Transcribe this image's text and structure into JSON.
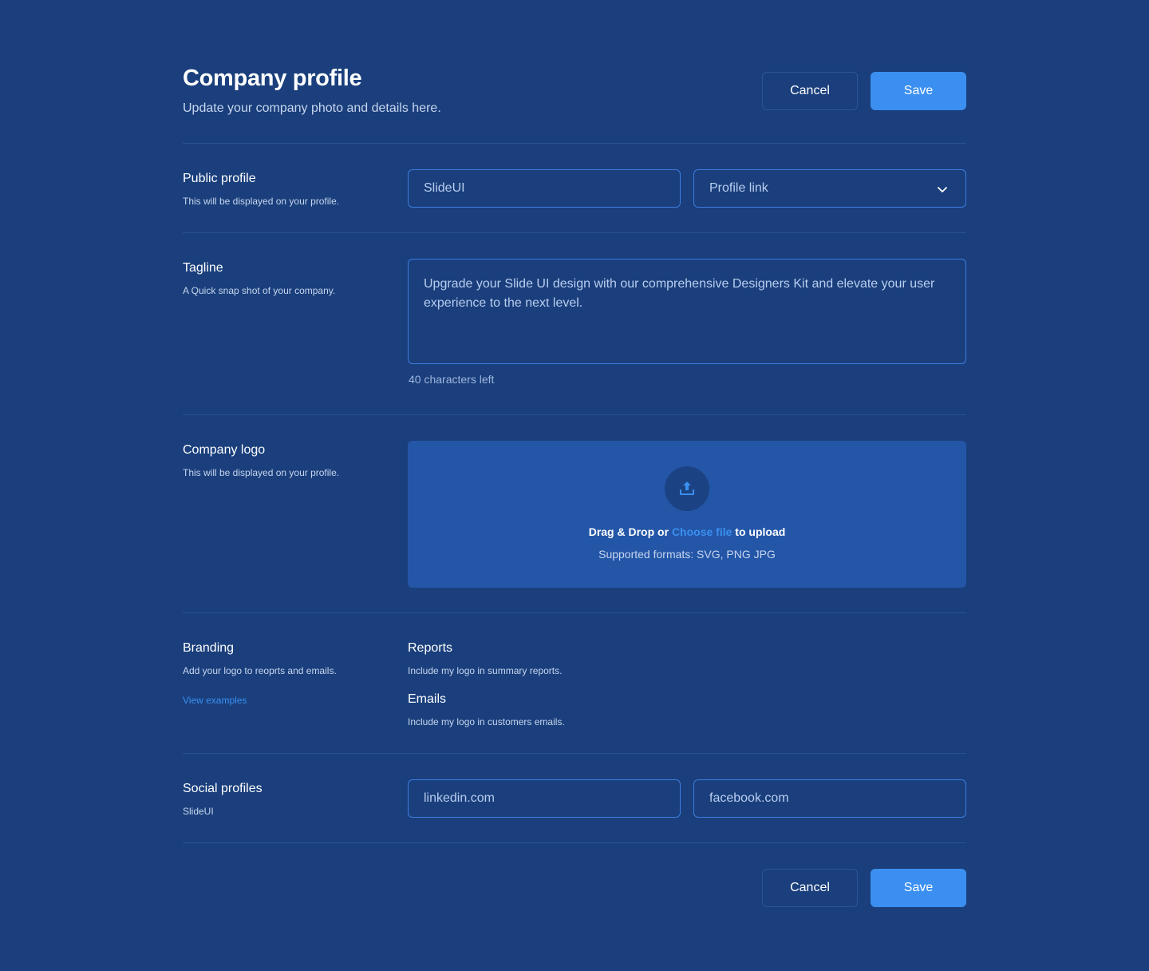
{
  "header": {
    "title": "Company profile",
    "subtitle": "Update your company photo and details here.",
    "cancel_label": "Cancel",
    "save_label": "Save"
  },
  "public_profile": {
    "title": "Public profile",
    "description": "This will be displayed on your profile.",
    "name_value": "SlideUI",
    "profile_link_placeholder": "Profile link",
    "chevron_icon": "chevron-down-icon"
  },
  "tagline": {
    "title": "Tagline",
    "description": "A Quick snap shot of your company.",
    "value": "Upgrade your Slide UI design with our comprehensive Designers Kit and elevate your user experience to the next level.",
    "helper": "40 characters left"
  },
  "company_logo": {
    "title": "Company logo",
    "description": "This will be displayed on your profile.",
    "upload_icon": "upload-icon",
    "drag_text": "Drag & Drop or",
    "choose_file": "Choose file",
    "to_upload": "to upload",
    "formats": "Supported formats: SVG, PNG JPG"
  },
  "branding": {
    "title": "Branding",
    "description": "Add your logo to reoprts and emails.",
    "view_examples": "View examples",
    "reports_title": "Reports",
    "reports_desc": "Include my logo in summary reports.",
    "emails_title": "Emails",
    "emails_desc": "Include my logo in customers emails."
  },
  "social": {
    "title": "Social profiles",
    "description": "SlideUI",
    "linkedin_value": "linkedin.com",
    "facebook_value": "facebook.com"
  },
  "footer": {
    "cancel_label": "Cancel",
    "save_label": "Save"
  },
  "colors": {
    "background": "#1a3f7c",
    "accent": "#3b8ff0",
    "upload_panel": "#2456a8",
    "field_border": "#3d7de0"
  }
}
